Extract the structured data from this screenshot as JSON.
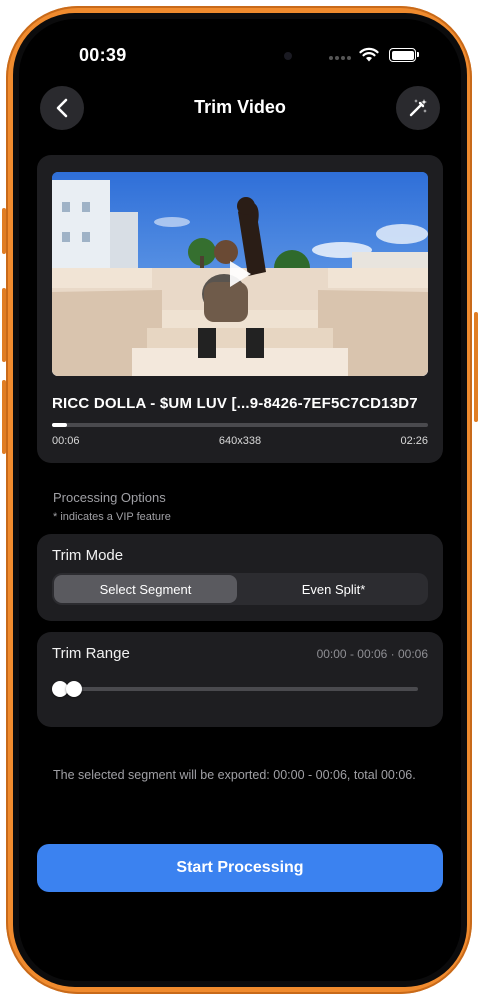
{
  "status_bar": {
    "time": "00:39"
  },
  "nav": {
    "title": "Trim Video",
    "back_icon": "chevron-left-icon",
    "magic_icon": "magic-wand-icon"
  },
  "video": {
    "title": "RICC DOLLA - $UM LUV [...9-8426-7EF5C7CD13D7",
    "current_time": "00:06",
    "resolution": "640x338",
    "duration": "02:26",
    "progress_fraction": 0.04
  },
  "processing": {
    "heading": "Processing Options",
    "note": "* indicates a VIP feature"
  },
  "trim_mode": {
    "title": "Trim Mode",
    "options": [
      "Select Segment",
      "Even Split*"
    ],
    "selected": "Select Segment"
  },
  "trim_range": {
    "title": "Trim Range",
    "range_text": "00:00 - 00:06 · 00:06",
    "start_fraction": 0.0,
    "end_fraction": 0.041
  },
  "export_note": "The selected segment will be exported: 00:00 - 00:06, total 00:06.",
  "actions": {
    "start_label": "Start Processing"
  },
  "colors": {
    "accent": "#3b82f0",
    "frame": "#f08b2e",
    "card": "#1e1e21"
  }
}
